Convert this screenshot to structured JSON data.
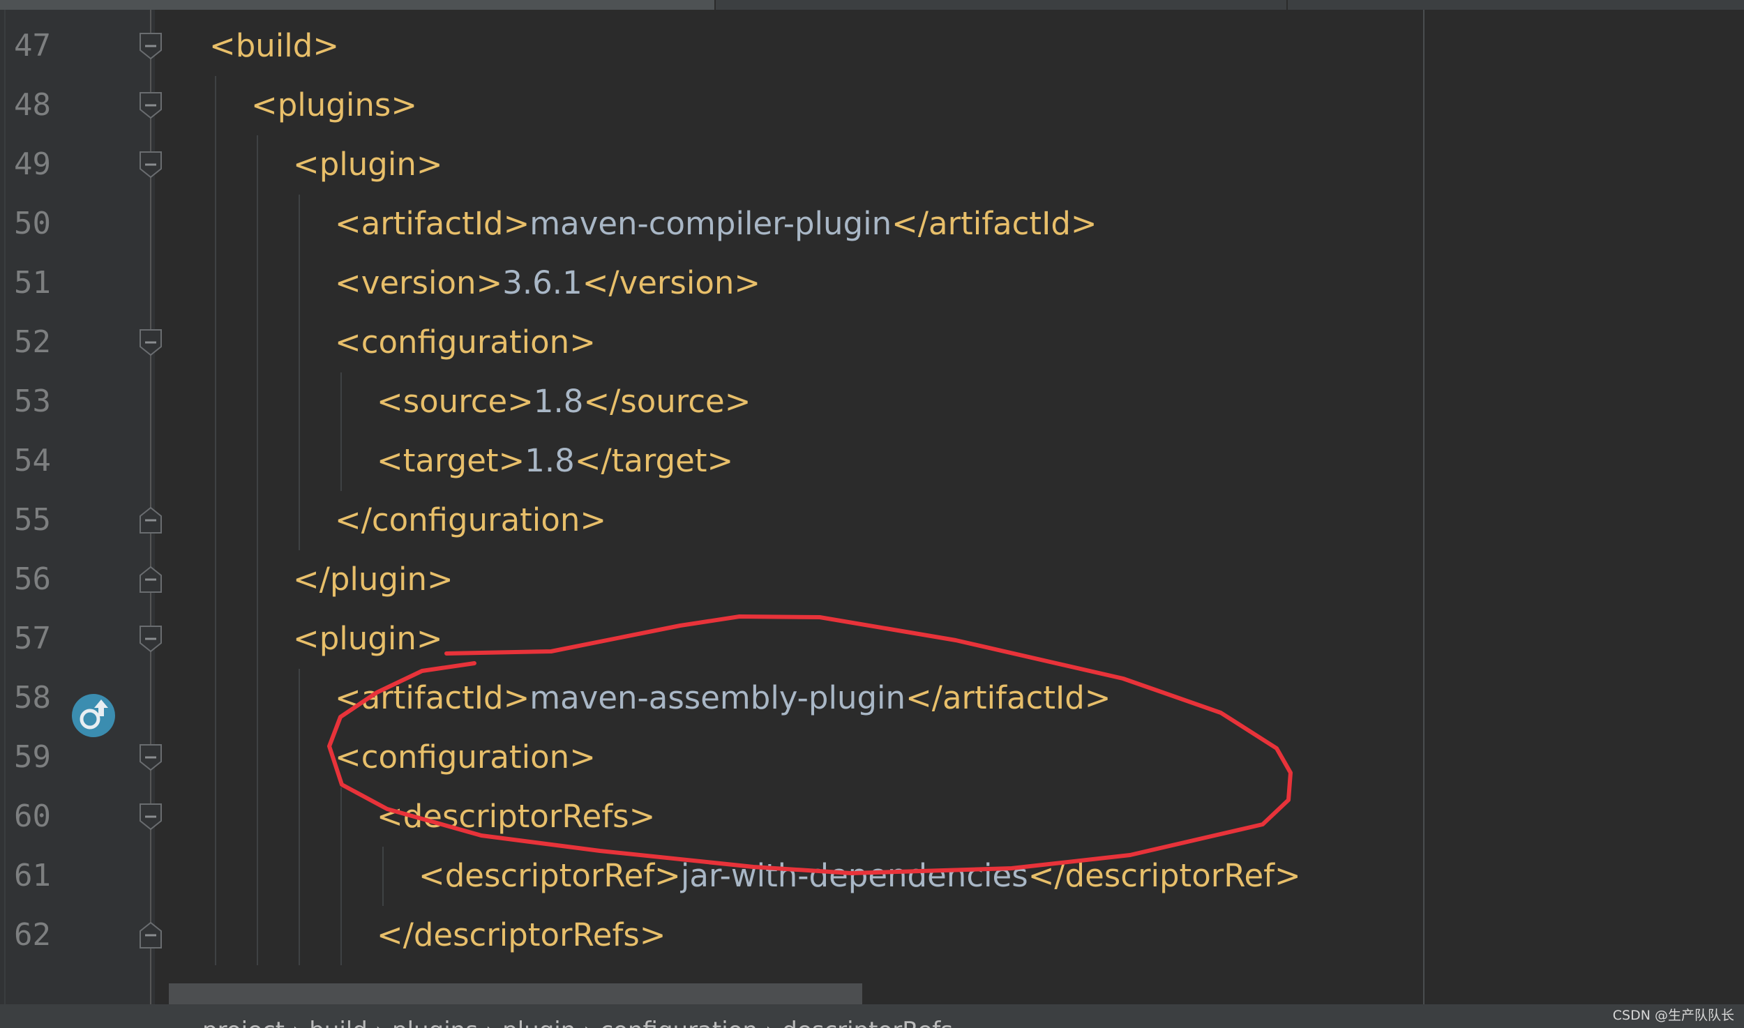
{
  "editor": {
    "lines": [
      {
        "num": "47",
        "fold": "open",
        "indent": 0,
        "segments": [
          {
            "t": "<build>",
            "k": "tag"
          }
        ]
      },
      {
        "num": "48",
        "fold": "open",
        "indent": 1,
        "segments": [
          {
            "t": "<plugins>",
            "k": "tag"
          }
        ]
      },
      {
        "num": "49",
        "fold": "open",
        "indent": 2,
        "segments": [
          {
            "t": "<plugin>",
            "k": "tag"
          }
        ]
      },
      {
        "num": "50",
        "fold": "",
        "indent": 3,
        "segments": [
          {
            "t": "<artifactId>",
            "k": "tag"
          },
          {
            "t": "maven-compiler-plugin",
            "k": "val"
          },
          {
            "t": "</artifactId>",
            "k": "tag"
          }
        ]
      },
      {
        "num": "51",
        "fold": "",
        "indent": 3,
        "segments": [
          {
            "t": "<version>",
            "k": "tag"
          },
          {
            "t": "3.6.1",
            "k": "val"
          },
          {
            "t": "</version>",
            "k": "tag"
          }
        ]
      },
      {
        "num": "52",
        "fold": "open",
        "indent": 3,
        "segments": [
          {
            "t": "<configuration>",
            "k": "tag"
          }
        ]
      },
      {
        "num": "53",
        "fold": "",
        "indent": 4,
        "segments": [
          {
            "t": "<source>",
            "k": "tag"
          },
          {
            "t": "1.8",
            "k": "val"
          },
          {
            "t": "</source>",
            "k": "tag"
          }
        ]
      },
      {
        "num": "54",
        "fold": "",
        "indent": 4,
        "segments": [
          {
            "t": "<target>",
            "k": "tag"
          },
          {
            "t": "1.8",
            "k": "val"
          },
          {
            "t": "</target>",
            "k": "tag"
          }
        ]
      },
      {
        "num": "55",
        "fold": "close",
        "indent": 3,
        "segments": [
          {
            "t": "</configuration>",
            "k": "tag"
          }
        ]
      },
      {
        "num": "56",
        "fold": "close",
        "indent": 2,
        "segments": [
          {
            "t": "</plugin>",
            "k": "tag"
          }
        ]
      },
      {
        "num": "57",
        "fold": "open",
        "indent": 2,
        "segments": [
          {
            "t": "<plugin>",
            "k": "tag"
          }
        ]
      },
      {
        "num": "58",
        "fold": "",
        "indent": 3,
        "segments": [
          {
            "t": "<artifactId>",
            "k": "tag"
          },
          {
            "t": "maven-assembly-plugin",
            "k": "val"
          },
          {
            "t": "</artifactId>",
            "k": "tag"
          }
        ]
      },
      {
        "num": "59",
        "fold": "open",
        "indent": 3,
        "segments": [
          {
            "t": "<configuration>",
            "k": "tag"
          }
        ]
      },
      {
        "num": "60",
        "fold": "open",
        "indent": 4,
        "segments": [
          {
            "t": "<descriptorRefs>",
            "k": "tag"
          }
        ]
      },
      {
        "num": "61",
        "fold": "",
        "indent": 5,
        "segments": [
          {
            "t": "<descriptorRef>",
            "k": "tag"
          },
          {
            "t": "jar-with-dependencies",
            "k": "val"
          },
          {
            "t": "</descriptorRef>",
            "k": "tag"
          }
        ]
      },
      {
        "num": "62",
        "fold": "close",
        "indent": 4,
        "segments": [
          {
            "t": "</descriptorRefs>",
            "k": "tag"
          }
        ]
      }
    ]
  },
  "gutter_icons": {
    "maven_line": "58",
    "icon": "maven-override-icon"
  },
  "annotation": {
    "color": "#e8333a",
    "shape": "hand-drawn-ellipse"
  },
  "colors": {
    "tag": "#e8bf6a",
    "value": "#a9b7c6",
    "background": "#2b2b2b",
    "line_number": "#7d7f80"
  },
  "breadcrumb": {
    "text": "project › build › plugins › plugin › configuration › descriptorRefs"
  },
  "watermark": {
    "text": "CSDN @生产队队长"
  }
}
